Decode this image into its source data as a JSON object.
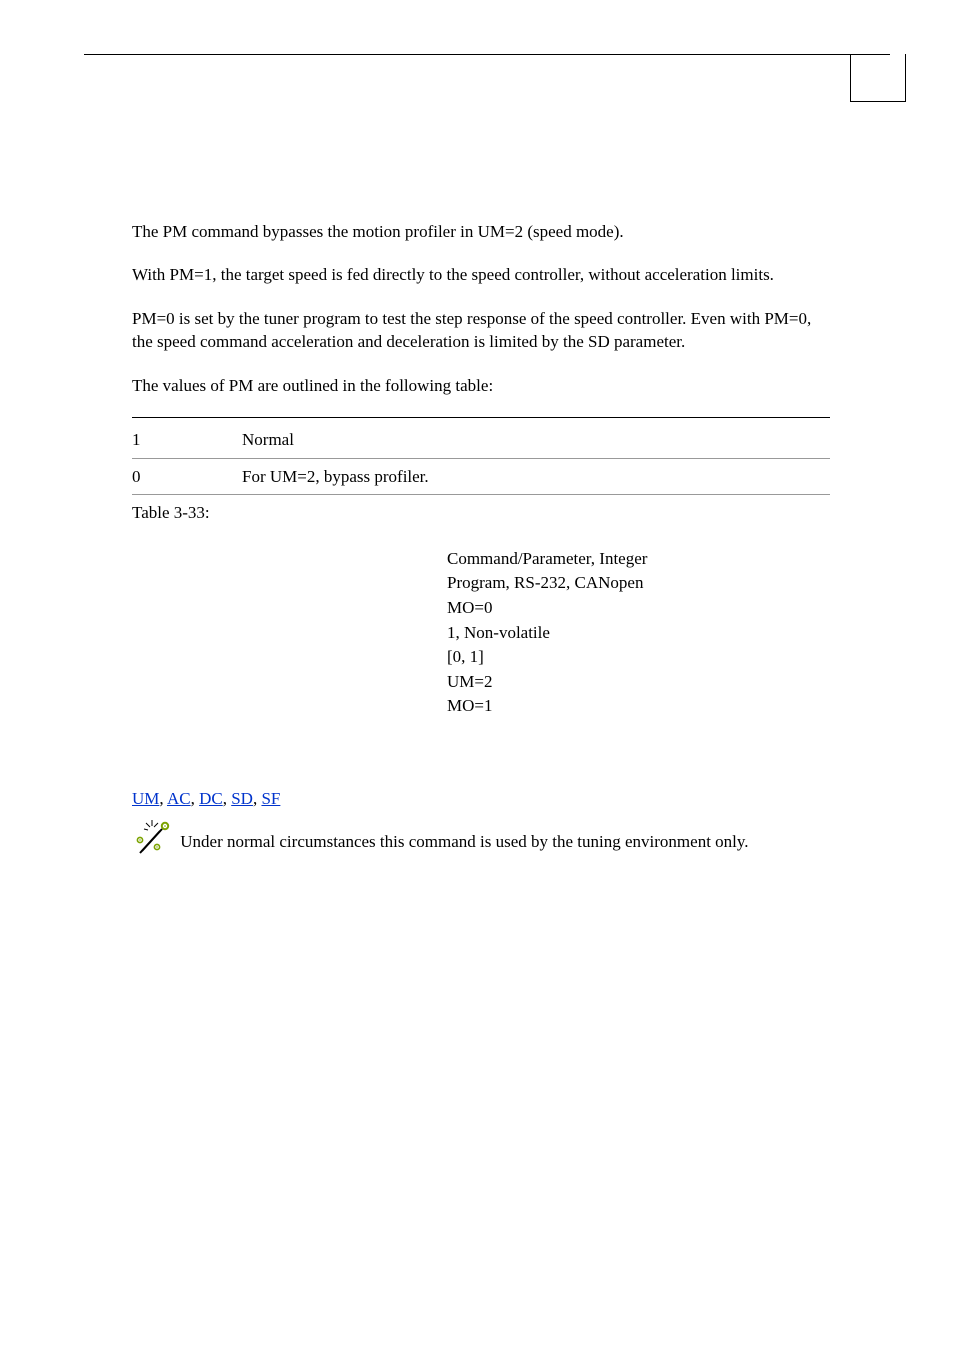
{
  "body": {
    "p1": "The PM command bypasses the motion profiler in UM=2 (speed mode).",
    "p2": "With PM=1, the target speed is fed directly to the speed controller, without acceleration limits.",
    "p3": "PM=0 is set by the tuner program to test the step response of the speed controller. Even with PM=0, the speed command acceleration and deceleration is limited by the SD parameter.",
    "p4": "The values of PM are outlined in the following table:"
  },
  "table": {
    "rows": [
      {
        "key": "1",
        "val": "Normal"
      },
      {
        "key": "0",
        "val": "For UM=2, bypass profiler."
      }
    ],
    "caption": "Table 3-33:"
  },
  "props": {
    "l1": "Command/Parameter, Integer",
    "l2": "Program, RS-232, CANopen",
    "l3": "MO=0",
    "l4": "1, Non-volatile",
    "l5": "[0, 1]",
    "l6": "UM=2",
    "l7": "MO=1"
  },
  "see_also": {
    "links": [
      "UM",
      "AC",
      "DC",
      "SD",
      "SF"
    ]
  },
  "note": {
    "text": " Under normal circumstances this command is used by the tuning environment only."
  }
}
